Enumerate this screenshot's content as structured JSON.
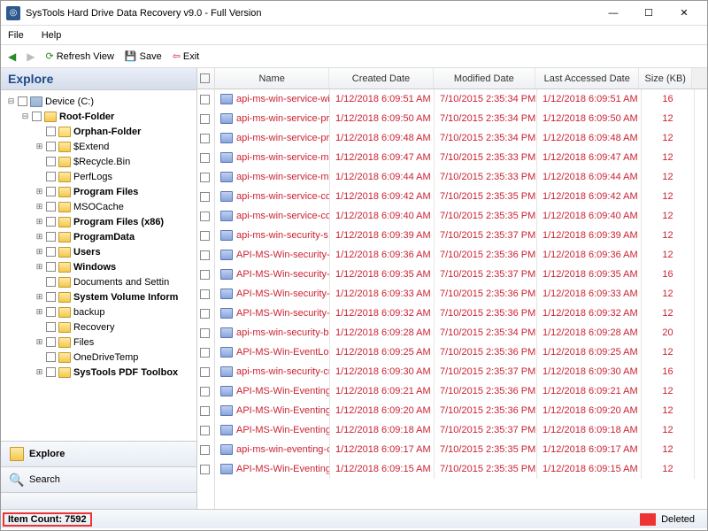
{
  "window": {
    "title": "SysTools Hard Drive Data Recovery v9.0 - Full Version",
    "min": "—",
    "max": "☐",
    "close": "✕"
  },
  "menubar": {
    "file": "File",
    "help": "Help"
  },
  "toolbar": {
    "refresh": "Refresh View",
    "save": "Save",
    "exit": "Exit"
  },
  "explore_label": "Explore",
  "tree": [
    {
      "ind": 0,
      "exp": "⊟",
      "icon": "drive",
      "label": "Device (C:)"
    },
    {
      "ind": 1,
      "exp": "⊟",
      "icon": "folder",
      "label": "Root-Folder",
      "bold": true
    },
    {
      "ind": 2,
      "exp": " ",
      "icon": "folder-o",
      "label": "Orphan-Folder",
      "bold": true
    },
    {
      "ind": 2,
      "exp": "⊞",
      "icon": "folder",
      "label": "$Extend"
    },
    {
      "ind": 2,
      "exp": " ",
      "icon": "folder",
      "label": "$Recycle.Bin"
    },
    {
      "ind": 2,
      "exp": " ",
      "icon": "folder",
      "label": "PerfLogs"
    },
    {
      "ind": 2,
      "exp": "⊞",
      "icon": "folder",
      "label": "Program Files",
      "bold": true
    },
    {
      "ind": 2,
      "exp": "⊞",
      "icon": "folder",
      "label": "MSOCache"
    },
    {
      "ind": 2,
      "exp": "⊞",
      "icon": "folder",
      "label": "Program Files (x86)",
      "bold": true
    },
    {
      "ind": 2,
      "exp": "⊞",
      "icon": "folder",
      "label": "ProgramData",
      "bold": true
    },
    {
      "ind": 2,
      "exp": "⊞",
      "icon": "folder",
      "label": "Users",
      "bold": true
    },
    {
      "ind": 2,
      "exp": "⊞",
      "icon": "folder",
      "label": "Windows",
      "bold": true
    },
    {
      "ind": 2,
      "exp": " ",
      "icon": "folder",
      "label": "Documents and Settin"
    },
    {
      "ind": 2,
      "exp": "⊞",
      "icon": "folder",
      "label": "System Volume Inform",
      "bold": true
    },
    {
      "ind": 2,
      "exp": "⊞",
      "icon": "folder",
      "label": "backup"
    },
    {
      "ind": 2,
      "exp": " ",
      "icon": "folder",
      "label": "Recovery"
    },
    {
      "ind": 2,
      "exp": "⊞",
      "icon": "folder",
      "label": "Files"
    },
    {
      "ind": 2,
      "exp": " ",
      "icon": "folder",
      "label": "OneDriveTemp"
    },
    {
      "ind": 2,
      "exp": "⊞",
      "icon": "folder",
      "label": "SysTools PDF Toolbox",
      "bold": true
    }
  ],
  "left_tabs": {
    "explore": "Explore",
    "search": "Search"
  },
  "columns": {
    "name": "Name",
    "cd": "Created Date",
    "md": "Modified Date",
    "ad": "Last Accessed Date",
    "sz": "Size (KB)"
  },
  "rows": [
    {
      "n": "api-ms-win-service-wi…",
      "cd": "1/12/2018 6:09:51 AM",
      "md": "7/10/2015 2:35:34 PM",
      "ad": "1/12/2018 6:09:51 AM",
      "sz": "16",
      "del": 1
    },
    {
      "n": "api-ms-win-service-pri…",
      "cd": "1/12/2018 6:09:50 AM",
      "md": "7/10/2015 2:35:34 PM",
      "ad": "1/12/2018 6:09:50 AM",
      "sz": "12",
      "del": 1
    },
    {
      "n": "api-ms-win-service-pri…",
      "cd": "1/12/2018 6:09:48 AM",
      "md": "7/10/2015 2:35:34 PM",
      "ad": "1/12/2018 6:09:48 AM",
      "sz": "12",
      "del": 1
    },
    {
      "n": "api-ms-win-service-ma…",
      "cd": "1/12/2018 6:09:47 AM",
      "md": "7/10/2015 2:35:33 PM",
      "ad": "1/12/2018 6:09:47 AM",
      "sz": "12",
      "del": 1
    },
    {
      "n": "api-ms-win-service-ma…",
      "cd": "1/12/2018 6:09:44 AM",
      "md": "7/10/2015 2:35:33 PM",
      "ad": "1/12/2018 6:09:44 AM",
      "sz": "12",
      "del": 1
    },
    {
      "n": "api-ms-win-service-co…",
      "cd": "1/12/2018 6:09:42 AM",
      "md": "7/10/2015 2:35:35 PM",
      "ad": "1/12/2018 6:09:42 AM",
      "sz": "12",
      "del": 1
    },
    {
      "n": "api-ms-win-service-co…",
      "cd": "1/12/2018 6:09:40 AM",
      "md": "7/10/2015 2:35:35 PM",
      "ad": "1/12/2018 6:09:40 AM",
      "sz": "12",
      "del": 1
    },
    {
      "n": "api-ms-win-security-s…",
      "cd": "1/12/2018 6:09:39 AM",
      "md": "7/10/2015 2:35:37 PM",
      "ad": "1/12/2018 6:09:39 AM",
      "sz": "12",
      "del": 1
    },
    {
      "n": "API-MS-Win-security-…",
      "cd": "1/12/2018 6:09:36 AM",
      "md": "7/10/2015 2:35:36 PM",
      "ad": "1/12/2018 6:09:36 AM",
      "sz": "12",
      "del": 1
    },
    {
      "n": "API-MS-Win-security-l…",
      "cd": "1/12/2018 6:09:35 AM",
      "md": "7/10/2015 2:35:37 PM",
      "ad": "1/12/2018 6:09:35 AM",
      "sz": "16",
      "del": 1
    },
    {
      "n": "API-MS-Win-security-l…",
      "cd": "1/12/2018 6:09:33 AM",
      "md": "7/10/2015 2:35:36 PM",
      "ad": "1/12/2018 6:09:33 AM",
      "sz": "12",
      "del": 1
    },
    {
      "n": "API-MS-Win-security-l…",
      "cd": "1/12/2018 6:09:32 AM",
      "md": "7/10/2015 2:35:36 PM",
      "ad": "1/12/2018 6:09:32 AM",
      "sz": "12",
      "del": 1
    },
    {
      "n": "api-ms-win-security-b…",
      "cd": "1/12/2018 6:09:28 AM",
      "md": "7/10/2015 2:35:34 PM",
      "ad": "1/12/2018 6:09:28 AM",
      "sz": "20",
      "del": 1
    },
    {
      "n": "API-MS-Win-EventLog…",
      "cd": "1/12/2018 6:09:25 AM",
      "md": "7/10/2015 2:35:36 PM",
      "ad": "1/12/2018 6:09:25 AM",
      "sz": "12",
      "del": 1
    },
    {
      "n": "api-ms-win-security-cr…",
      "cd": "1/12/2018 6:09:30 AM",
      "md": "7/10/2015 2:35:37 PM",
      "ad": "1/12/2018 6:09:30 AM",
      "sz": "16",
      "del": 1
    },
    {
      "n": "API-MS-Win-Eventing-…",
      "cd": "1/12/2018 6:09:21 AM",
      "md": "7/10/2015 2:35:36 PM",
      "ad": "1/12/2018 6:09:21 AM",
      "sz": "12",
      "del": 1
    },
    {
      "n": "API-MS-Win-Eventing-…",
      "cd": "1/12/2018 6:09:20 AM",
      "md": "7/10/2015 2:35:36 PM",
      "ad": "1/12/2018 6:09:20 AM",
      "sz": "12",
      "del": 1
    },
    {
      "n": "API-MS-Win-Eventing-…",
      "cd": "1/12/2018 6:09:18 AM",
      "md": "7/10/2015 2:35:37 PM",
      "ad": "1/12/2018 6:09:18 AM",
      "sz": "12",
      "del": 1
    },
    {
      "n": "api-ms-win-eventing-c…",
      "cd": "1/12/2018 6:09:17 AM",
      "md": "7/10/2015 2:35:35 PM",
      "ad": "1/12/2018 6:09:17 AM",
      "sz": "12",
      "del": 1
    },
    {
      "n": "API-MS-Win-Eventing-…",
      "cd": "1/12/2018 6:09:15 AM",
      "md": "7/10/2015 2:35:35 PM",
      "ad": "1/12/2018 6:09:15 AM",
      "sz": "12",
      "del": 1
    }
  ],
  "status": {
    "count": "Item Count: 7592",
    "legend": "Deleted"
  }
}
